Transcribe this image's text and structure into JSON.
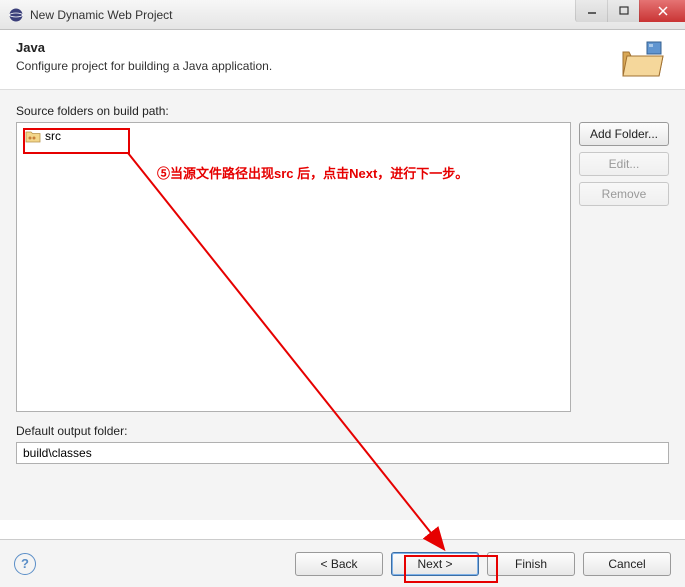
{
  "window": {
    "title": "New Dynamic Web Project"
  },
  "header": {
    "title": "Java",
    "description": "Configure project for building a Java application."
  },
  "source_folders": {
    "label": "Source folders on build path:",
    "items": [
      "src"
    ]
  },
  "side_buttons": {
    "add": "Add Folder...",
    "edit": "Edit...",
    "remove": "Remove"
  },
  "output": {
    "label": "Default output folder:",
    "value": "build\\classes"
  },
  "footer": {
    "back": "< Back",
    "next": "Next >",
    "finish": "Finish",
    "cancel": "Cancel"
  },
  "annotation": {
    "text": "⑤当源文件路径出现src 后，点击Next，进行下一步。"
  }
}
